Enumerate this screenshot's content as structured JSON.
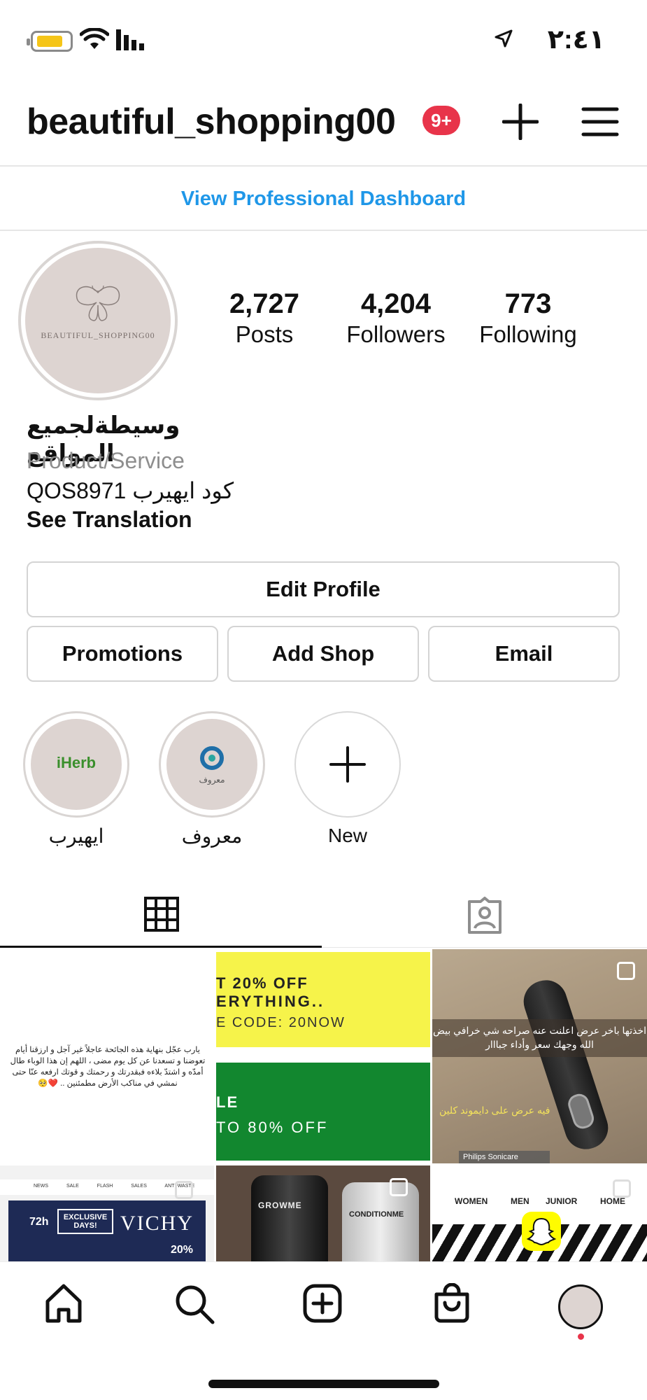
{
  "status_bar": {
    "time": "٢:٤١"
  },
  "header": {
    "username": "beautiful_shopping00",
    "notification_badge": "9+"
  },
  "dashboard_link": "View Professional Dashboard",
  "profile": {
    "avatar_text": "BEAUTIFUL_SHOPPING00",
    "stats": [
      {
        "value": "2,727",
        "label": "Posts"
      },
      {
        "value": "4,204",
        "label": "Followers"
      },
      {
        "value": "773",
        "label": "Following"
      }
    ],
    "bio_name": "وسيطةلجميع المواقع",
    "category": "Product/Service",
    "bio_line": "QOS8971 كود ايهيرب",
    "see_translation": "See Translation"
  },
  "buttons": {
    "edit_profile": "Edit Profile",
    "promotions": "Promotions",
    "add_shop": "Add Shop",
    "email": "Email"
  },
  "highlights": [
    {
      "label": "ايهيرب",
      "logo_text": "iHerb"
    },
    {
      "label": "معروف",
      "logo_text": "معروف"
    },
    {
      "label": "New"
    }
  ],
  "posts": {
    "p1_text": "يارب عجّل بنهاية هذه الجائحة عاجلاً غير آجل و ارزقنا أيام تعوضنا و تسعدنا عن كل يوم مضى ، اللهم إن هذا الوباء طال أمدّه و اشتدّ بلاءه فبقدرتك و رحمتك و قوتك ارفعه عنّا حتى نمشي في مناكب الأرض مطمئنين .. ❤️🥺",
    "p2_line1": "T 20% OFF",
    "p2_line2": "ERYTHING..",
    "p2_line3": "E CODE: 20NOW",
    "p2_line4": "LE",
    "p2_line5": "TO 80% OFF",
    "p3_caption": "اخذتها باخر عرض اعلنت عنه صراحه شي خرافي بيض الله وجهك سعر وأداء جبااار",
    "p3_offer": "فيه عرض على دايموند كلين",
    "p3_bar": "Philips Sonicare",
    "p4_nav": "NEWS SALE FLASH SALES ANTI-WASTE",
    "p4_brand": "VICHY",
    "p4_exclusive": "EXCLUSIVE DAYS!",
    "p4_hours": "72h",
    "p4_pct": "20%",
    "p5_brand1": "GROWME",
    "p5_brand2": "CONDITIONME",
    "p6_menu": [
      "WOMEN",
      "MEN",
      "JUNIOR",
      "HOME"
    ]
  }
}
